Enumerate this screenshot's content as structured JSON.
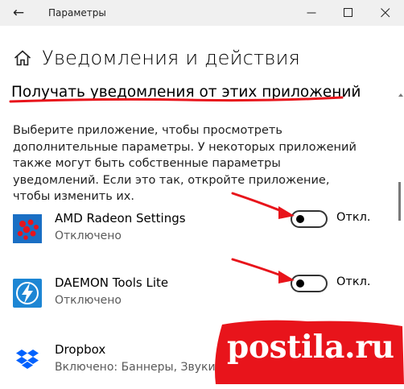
{
  "window": {
    "title": "Параметры",
    "back_glyph": "←"
  },
  "header": {
    "title": "Уведомления и действия",
    "home_icon": "home-icon"
  },
  "section": {
    "title": "Получать уведомления от этих приложений",
    "description": "Выберите приложение, чтобы просмотреть дополнительные параметры. У некоторых приложений также могут быть собственные параметры уведомлений. Если это так, откройте приложение, чтобы изменить их."
  },
  "apps": [
    {
      "name": "AMD Radeon Settings",
      "status": "Отключено",
      "toggle_state": false,
      "toggle_label": "Откл.",
      "icon": "amd-radeon-icon"
    },
    {
      "name": "DAEMON Tools Lite",
      "status": "Отключено",
      "toggle_state": false,
      "toggle_label": "Откл.",
      "icon": "daemon-tools-icon"
    },
    {
      "name": "Dropbox",
      "status": "Включено: Баннеры, Звуки",
      "icon": "dropbox-icon"
    }
  ],
  "watermark": {
    "text": "postila.ru"
  },
  "colors": {
    "annotation_red": "#e8141b",
    "amd_blue": "#1a6fc4",
    "daemon_blue": "#1d86d4",
    "dropbox_blue": "#0061fe",
    "titlebar": "#f0f0f0"
  }
}
